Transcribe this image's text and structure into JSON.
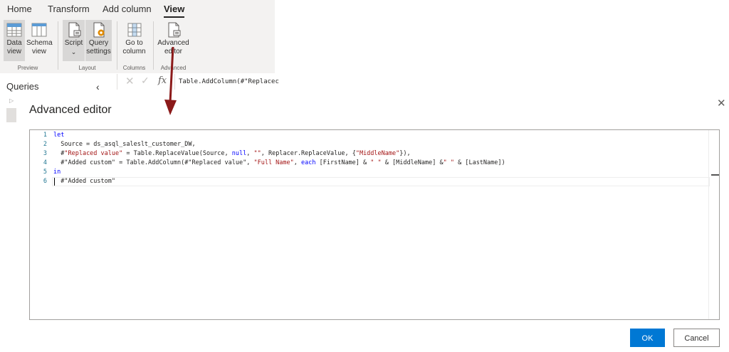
{
  "ribbon": {
    "tabs": [
      "Home",
      "Transform",
      "Add column",
      "View"
    ],
    "active_tab": "View",
    "buttons": {
      "data_view": [
        "Data",
        "view"
      ],
      "schema_view": [
        "Schema",
        "view"
      ],
      "script": [
        "Script",
        ""
      ],
      "query_settings": [
        "Query",
        "settings"
      ],
      "go_to_column": [
        "Go to",
        "column"
      ],
      "advanced_editor": [
        "Advanced",
        "editor"
      ]
    },
    "groups": {
      "preview": "Preview",
      "layout": "Layout",
      "columns": "Columns",
      "advanced": "Advanced"
    },
    "chevron": "⌄"
  },
  "queries": {
    "title": "Queries",
    "collapse_glyph": "‹",
    "expand_glyph": "▷"
  },
  "formula_bar": {
    "cancel_glyph": "✕",
    "confirm_glyph": "✓",
    "fx": "fx",
    "text": "Table.AddColumn(#\"Replacec"
  },
  "dialog": {
    "title": "Advanced editor",
    "close_glyph": "✕",
    "ok_label": "OK",
    "cancel_label": "Cancel"
  },
  "code_lines": [
    {
      "n": "1",
      "tokens": [
        {
          "t": "let",
          "c": "kw"
        }
      ]
    },
    {
      "n": "2",
      "tokens": [
        {
          "t": "  Source = ds_asql_saleslt_customer_DW,",
          "c": ""
        }
      ]
    },
    {
      "n": "3",
      "tokens": [
        {
          "t": "  #",
          "c": ""
        },
        {
          "t": "\"Replaced value\"",
          "c": "str"
        },
        {
          "t": " = Table.ReplaceValue(Source, ",
          "c": ""
        },
        {
          "t": "null",
          "c": "kw"
        },
        {
          "t": ", ",
          "c": ""
        },
        {
          "t": "\"\"",
          "c": "str"
        },
        {
          "t": ", Replacer.ReplaceValue, {",
          "c": ""
        },
        {
          "t": "\"MiddleName\"",
          "c": "str"
        },
        {
          "t": "}),",
          "c": ""
        }
      ]
    },
    {
      "n": "4",
      "tokens": [
        {
          "t": "  #\"Added custom\" = Table.AddColumn(#\"Replaced value\", ",
          "c": ""
        },
        {
          "t": "\"Full Name\"",
          "c": "str"
        },
        {
          "t": ", ",
          "c": ""
        },
        {
          "t": "each",
          "c": "kw"
        },
        {
          "t": " [FirstName] & ",
          "c": ""
        },
        {
          "t": "\" \"",
          "c": "str"
        },
        {
          "t": " & [MiddleName] &",
          "c": ""
        },
        {
          "t": "\" \"",
          "c": "str"
        },
        {
          "t": " & [LastName])",
          "c": ""
        }
      ]
    },
    {
      "n": "5",
      "tokens": [
        {
          "t": "in",
          "c": "kw"
        }
      ]
    },
    {
      "n": "6",
      "tokens": [
        {
          "t": "  #\"Added custom\"",
          "c": ""
        }
      ]
    }
  ],
  "colors": {
    "accent": "#0078d4",
    "arrow": "#8b1a1a",
    "keyword": "#0000ff",
    "string": "#a31515"
  }
}
